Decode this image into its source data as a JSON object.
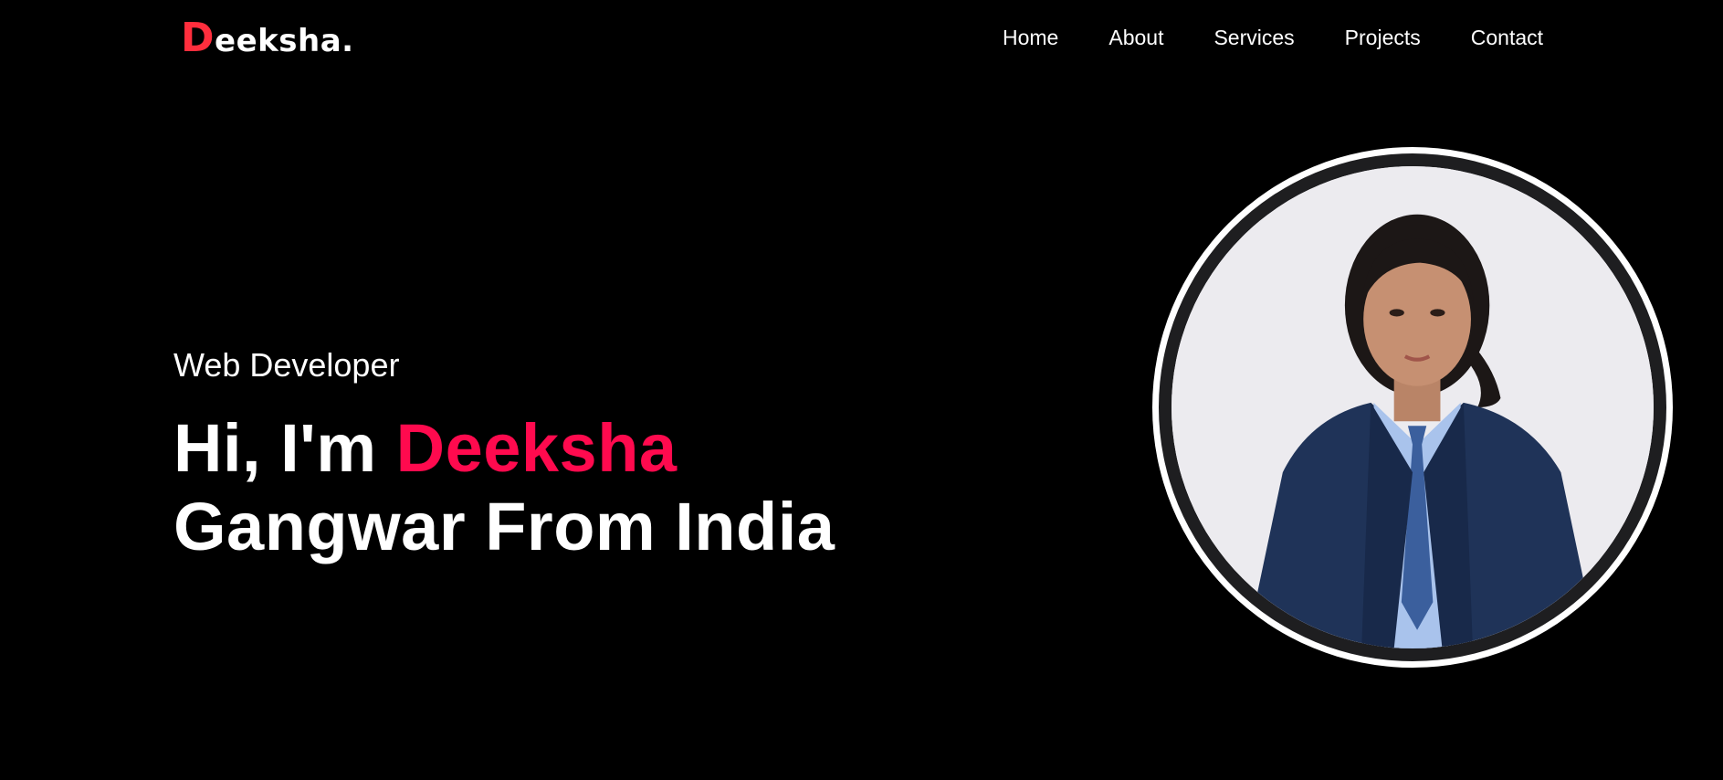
{
  "header": {
    "logo_first_letter": "D",
    "logo_rest": "eeksha.",
    "nav": [
      {
        "label": "Home"
      },
      {
        "label": "About"
      },
      {
        "label": "Services"
      },
      {
        "label": "Projects"
      },
      {
        "label": "Contact"
      }
    ]
  },
  "hero": {
    "role": "Web Developer",
    "greeting": "Hi, I'm ",
    "name_highlight": "Deeksha",
    "line2": "Gangwar From India"
  },
  "colors": {
    "background": "#000000",
    "logo_accent": "#ff2e3d",
    "name_accent": "#ff0a4e",
    "text": "#ffffff"
  },
  "icons": {
    "profile": "profile-photo"
  }
}
